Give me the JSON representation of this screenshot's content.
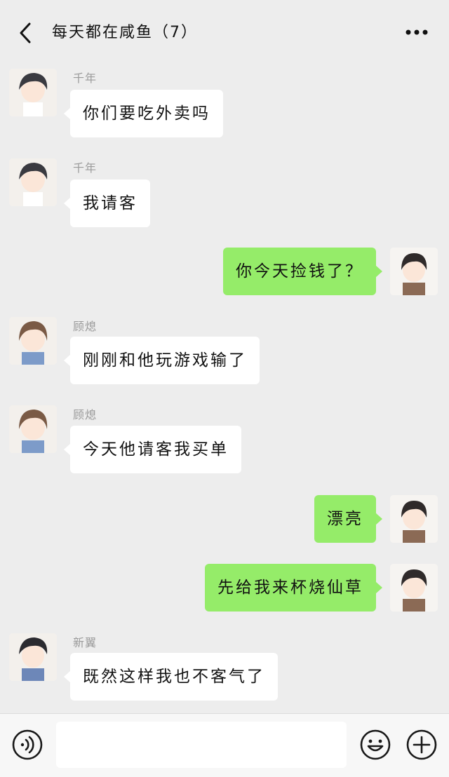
{
  "header": {
    "title": "每天都在咸鱼（7）"
  },
  "messages": [
    {
      "sender": "千年",
      "text": "你们要吃外卖吗"
    },
    {
      "sender": "千年",
      "text": "我请客"
    },
    {
      "text": "你今天捡钱了？"
    },
    {
      "sender": "顾熄",
      "text": "刚刚和他玩游戏输了"
    },
    {
      "sender": "顾熄",
      "text": "今天他请客我买单"
    },
    {
      "text": "漂亮"
    },
    {
      "text": "先给我来杯烧仙草"
    },
    {
      "sender": "新翼",
      "text": "既然这样我也不客气了"
    }
  ],
  "input": {
    "value": ""
  },
  "icons": {
    "back": "back-arrow-icon",
    "more": "more-dots-icon",
    "voice": "voice-icon",
    "emoji": "emoji-icon",
    "add": "plus-icon"
  },
  "colors": {
    "background": "#ededed",
    "incoming_bubble": "#ffffff",
    "outgoing_bubble": "#95ec69"
  }
}
